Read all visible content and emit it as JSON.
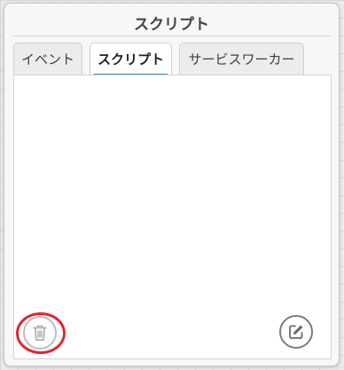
{
  "panel": {
    "title": "スクリプト"
  },
  "tabs": [
    {
      "label": "イベント",
      "active": false
    },
    {
      "label": "スクリプト",
      "active": true
    },
    {
      "label": "サービスワーカー",
      "active": false
    }
  ],
  "actions": {
    "delete_icon": "trash-icon",
    "edit_icon": "edit-icon"
  },
  "colors": {
    "active_tab_underline": "#4a90c8",
    "highlight_ring": "#e0262e"
  }
}
